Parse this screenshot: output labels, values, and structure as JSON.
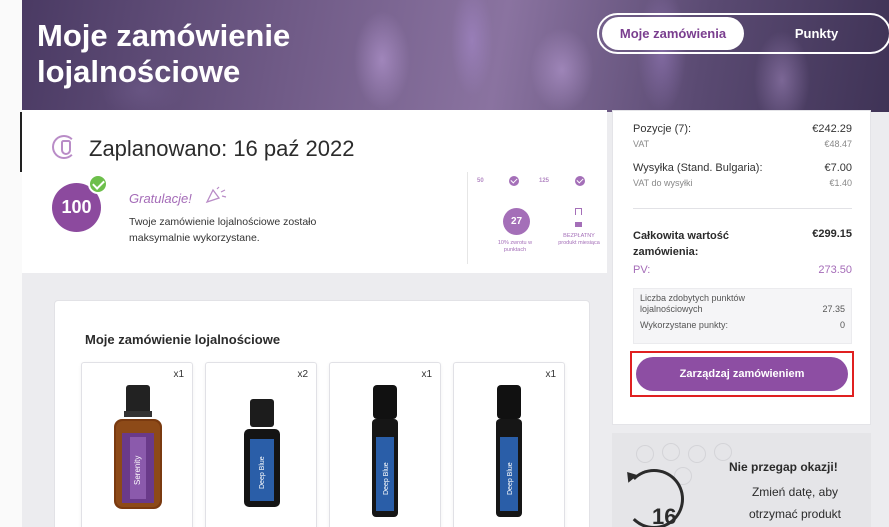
{
  "header": {
    "title_line1": "Moje zamówienie",
    "title_line2": "lojalnościowe",
    "tabs": [
      {
        "label": "Moje zamówienia",
        "active": true
      },
      {
        "label": "Punkty",
        "active": false
      }
    ]
  },
  "schedule": {
    "title": "Zaplanowano: 16 paź 2022",
    "badge_value": "100",
    "congrats": "Gratulacje!",
    "message": "Twoje zamówienie lojalnościowe zostało maksymalnie wykorzystane.",
    "ladder": {
      "tier1": "50",
      "tier2": "125",
      "points_value": "27",
      "points_caption": "10% zwrotu w punktach",
      "free_caption": "BEZPŁATNY produkt miesiąca"
    }
  },
  "products": {
    "title": "Moje zamówienie lojalnościowe",
    "items": [
      {
        "qty": "x1",
        "name": "Serenity",
        "label_color": "#7b4aa0"
      },
      {
        "qty": "x2",
        "name": "Deep Blue",
        "label_color": "#2a5ea8"
      },
      {
        "qty": "x1",
        "name": "Deep Blue",
        "label_color": "#2a5ea8"
      },
      {
        "qty": "x1",
        "name": "Deep Blue",
        "label_color": "#2a5ea8"
      }
    ]
  },
  "summary": {
    "items_label": "Pozycje (7):",
    "items_value": "€242.29",
    "vat_label": "VAT",
    "vat_value": "€48.47",
    "shipping_label": "Wysyłka (Stand. Bulgaria):",
    "shipping_value": "€7.00",
    "shipping_vat_label": "VAT do wysyłki",
    "shipping_vat_value": "€1.40",
    "total_label": "Całkowita wartość zamówienia:",
    "total_value": "€299.15",
    "pv_label": "PV:",
    "pv_value": "273.50",
    "earned_label": "Liczba zdobytych punktów lojalnościowych",
    "earned_value": "27.35",
    "used_label": "Wykorzystane punkty:",
    "used_value": "0",
    "manage_button": "Zarządzaj zamówieniem"
  },
  "promo": {
    "headline": "Nie przegap okazji!",
    "body": "Zmień datę, aby otrzymać produkt",
    "day": "16"
  },
  "colors": {
    "brand_purple": "#8d4ea3",
    "accent_lilac": "#a56cb8",
    "highlight_red": "#e02020",
    "check_green": "#6dbf4b"
  }
}
